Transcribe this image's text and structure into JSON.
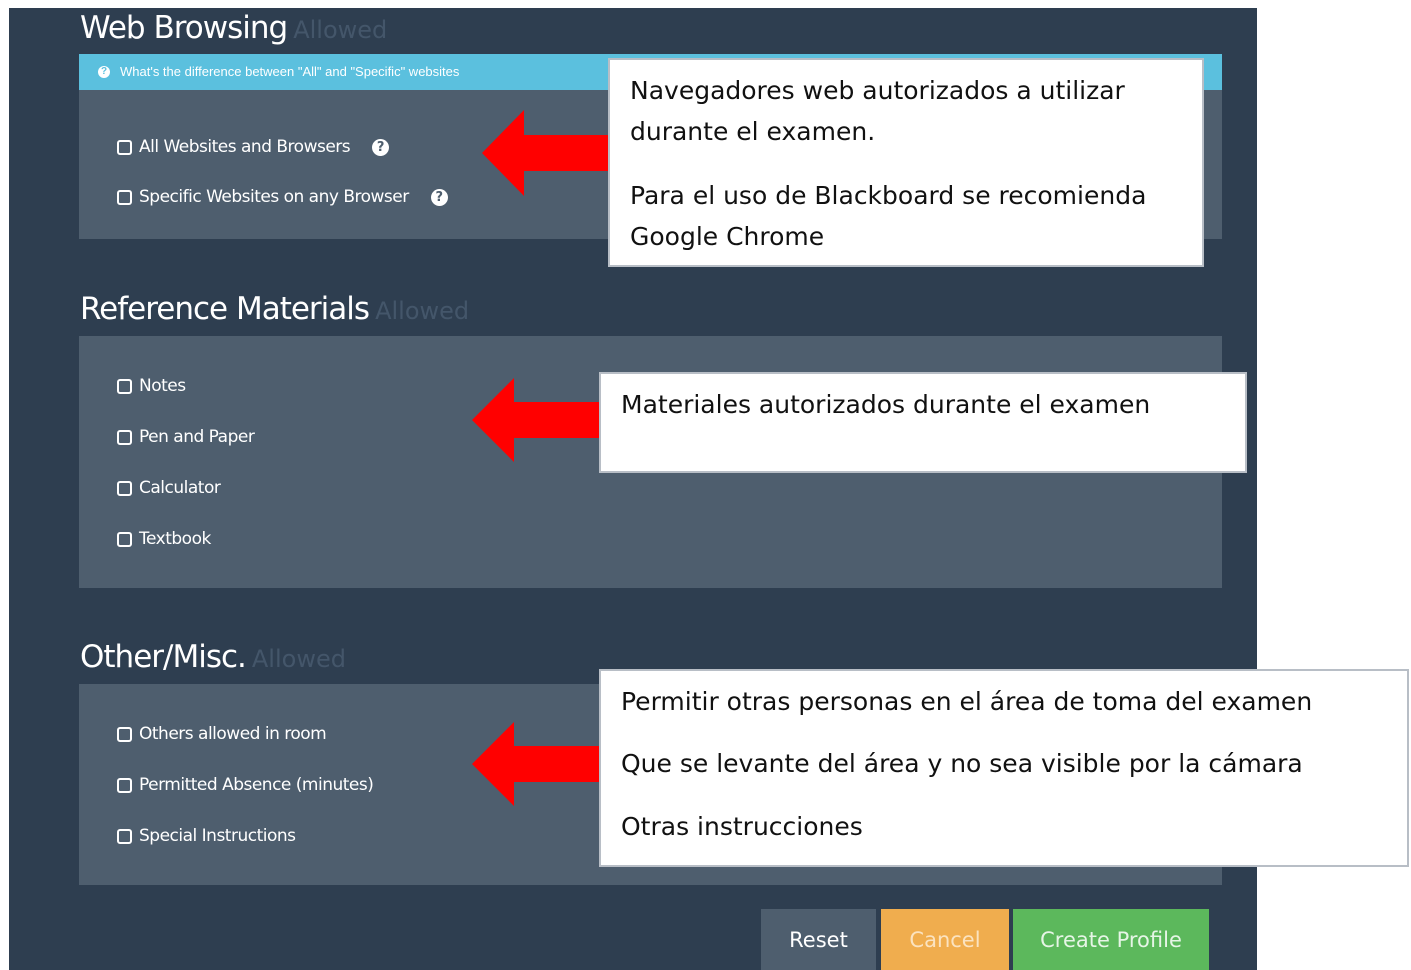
{
  "web_browsing": {
    "title": "Web Browsing",
    "subtitle": "Allowed",
    "info": "What's the difference between \"All\" and \"Specific\" websites",
    "options": [
      {
        "label": "All Websites and Browsers"
      },
      {
        "label": "Specific Websites on any Browser"
      }
    ]
  },
  "reference": {
    "title": "Reference Materials",
    "subtitle": "Allowed",
    "options": [
      {
        "label": "Notes"
      },
      {
        "label": "Pen and Paper"
      },
      {
        "label": "Calculator"
      },
      {
        "label": "Textbook"
      }
    ]
  },
  "other": {
    "title": "Other/Misc.",
    "subtitle": "Allowed",
    "options": [
      {
        "label": "Others allowed in room"
      },
      {
        "label": "Permitted Absence (minutes)"
      },
      {
        "label": "Special Instructions"
      }
    ]
  },
  "buttons": {
    "reset": "Reset",
    "cancel": "Cancel",
    "create": "Create Profile"
  },
  "callouts": {
    "browsers": {
      "line1": "Navegadores web autorizados a utilizar",
      "line2": "durante el examen.",
      "line3": "Para el uso de Blackboard se recomienda",
      "line4": "Google Chrome"
    },
    "materials": {
      "line1": "Materiales autorizados durante el examen"
    },
    "others": {
      "line1": "Permitir otras personas en el área de toma del examen",
      "line2": "Que se levante del área y no sea visible por la cámara",
      "line3": "Otras instrucciones"
    }
  },
  "colors": {
    "page_bg": "#2e3e50",
    "panel_bg": "#4e5e6e",
    "info_bar": "#5bc0de",
    "cancel": "#f0ad4e",
    "create": "#5cb85c",
    "arrow": "#ff0000"
  }
}
